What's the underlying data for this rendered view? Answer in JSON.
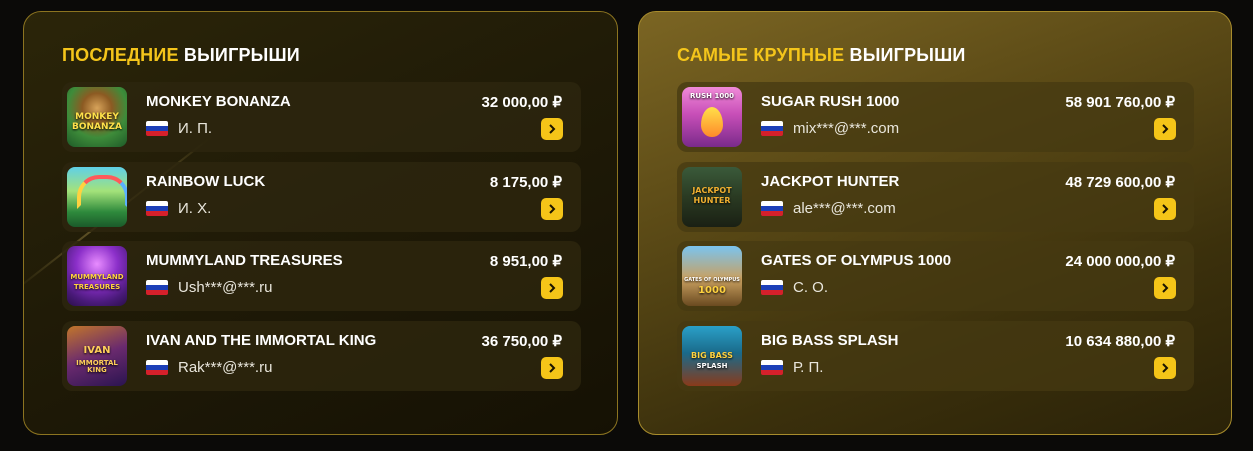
{
  "recent": {
    "title_accent": "ПОСЛЕДНИЕ",
    "title_rest": "ВЫИГРЫШИ",
    "items": [
      {
        "game": "MONKEY BONANZA",
        "amount": "32 000,00 ₽",
        "player": "И. П.",
        "flag": "russia-flag",
        "thumb_line1": "MONKEY",
        "thumb_line2": "BONANZA"
      },
      {
        "game": "RAINBOW LUCK",
        "amount": "8 175,00 ₽",
        "player": "И. Х.",
        "flag": "russia-flag",
        "thumb_line1": "",
        "thumb_line2": ""
      },
      {
        "game": "MUMMYLAND TREASURES",
        "amount": "8 951,00 ₽",
        "player": "Ush***@***.ru",
        "flag": "russia-flag",
        "thumb_line1": "MUMMYLAND",
        "thumb_line2": "TREASURES"
      },
      {
        "game": "IVAN AND THE IMMORTAL KING",
        "amount": "36 750,00 ₽",
        "player": "Rak***@***.ru",
        "flag": "russia-flag",
        "thumb_line1": "IVAN",
        "thumb_line2": "IMMORTAL KING"
      }
    ]
  },
  "biggest": {
    "title_accent": "САМЫЕ КРУПНЫЕ",
    "title_rest": "ВЫИГРЫШИ",
    "items": [
      {
        "game": "SUGAR RUSH 1000",
        "amount": "58 901 760,00 ₽",
        "player": "mix***@***.com",
        "flag": "russia-flag",
        "thumb_line1": "RUSH 1000",
        "thumb_line2": ""
      },
      {
        "game": "JACKPOT HUNTER",
        "amount": "48 729 600,00 ₽",
        "player": "ale***@***.com",
        "flag": "russia-flag",
        "thumb_line1": "JACKPOT",
        "thumb_line2": "HUNTER"
      },
      {
        "game": "GATES OF OLYMPUS 1000",
        "amount": "24 000 000,00 ₽",
        "player": "С. О.",
        "flag": "russia-flag",
        "thumb_line1": "GATES OF OLYMPUS",
        "thumb_line2": "1000"
      },
      {
        "game": "BIG BASS SPLASH",
        "amount": "10 634 880,00 ₽",
        "player": "Р. П.",
        "flag": "russia-flag",
        "thumb_line1": "BIG BASS",
        "thumb_line2": "SPLASH"
      }
    ]
  },
  "colors": {
    "accent": "#f4c51b",
    "button": "#f5c518",
    "text": "#ffffff"
  },
  "icons": {
    "arrow": "chevron-right-icon"
  }
}
